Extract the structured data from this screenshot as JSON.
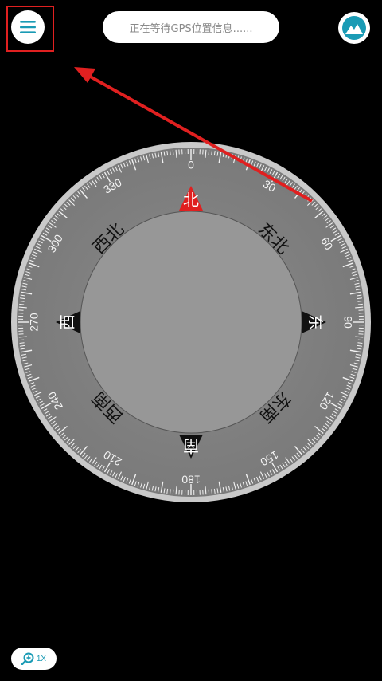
{
  "header": {
    "gps_status": "正在等待GPS位置信息......"
  },
  "compass": {
    "directions": {
      "north": "北",
      "northeast": "东北",
      "east": "东",
      "southeast": "东南",
      "south": "南",
      "southwest": "西南",
      "west": "西",
      "northwest": "西北"
    },
    "degree_labels": [
      "0",
      "30",
      "60",
      "90",
      "120",
      "150",
      "180",
      "210",
      "240",
      "270",
      "300",
      "330"
    ]
  },
  "zoom": {
    "label": "1X"
  },
  "colors": {
    "accent": "#1a9bb5",
    "north_marker": "#e02020",
    "annotation": "#e02020"
  },
  "icons": {
    "menu": "hamburger-icon",
    "map": "mountain-icon",
    "zoom": "zoom-in-icon"
  }
}
